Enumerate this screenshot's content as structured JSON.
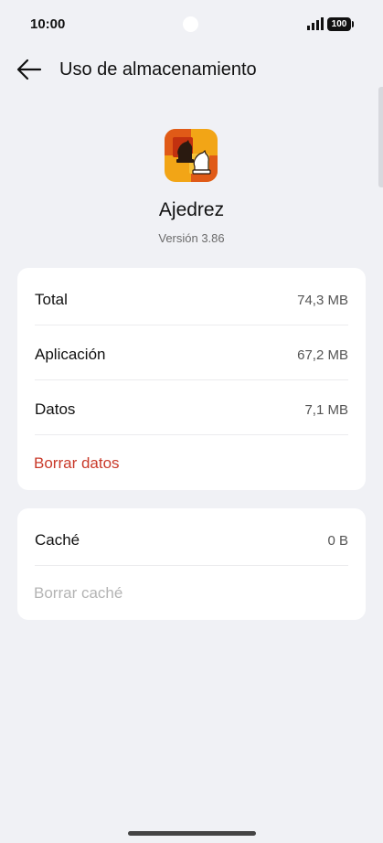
{
  "status_bar": {
    "time": "10:00",
    "battery": "100"
  },
  "header": {
    "title": "Uso de almacenamiento"
  },
  "app": {
    "name": "Ajedrez",
    "version": "Versión 3.86"
  },
  "storage": {
    "rows": [
      {
        "label": "Total",
        "value": "74,3 MB"
      },
      {
        "label": "Aplicación",
        "value": "67,2 MB"
      },
      {
        "label": "Datos",
        "value": "7,1 MB"
      }
    ],
    "clear_data_label": "Borrar datos"
  },
  "cache": {
    "label": "Caché",
    "value": "0 B",
    "clear_cache_label": "Borrar caché"
  },
  "colors": {
    "danger": "#c93a2a",
    "disabled": "#b4b4b4",
    "background": "#f0f1f5"
  }
}
